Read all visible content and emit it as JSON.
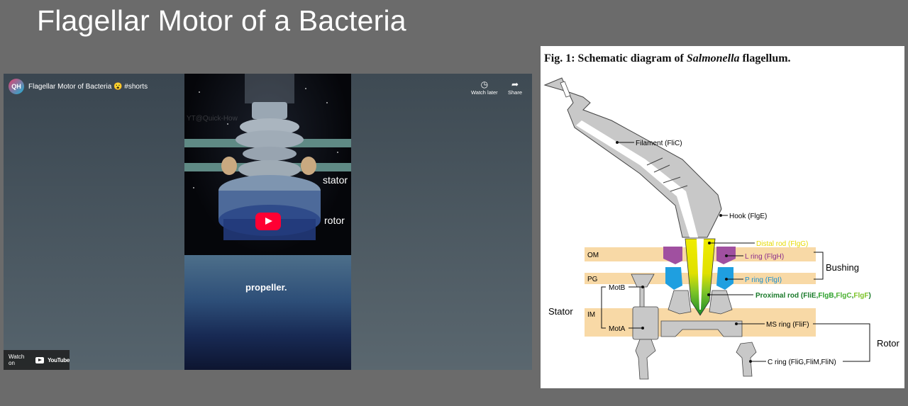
{
  "slide": {
    "title": "Flagellar Motor of a Bacteria"
  },
  "video": {
    "channel_avatar": "QH",
    "title": "Flagellar Motor of Bacteria 😮 #shorts",
    "watch_later_label": "Watch later",
    "share_label": "Share",
    "watch_on_label": "Watch on",
    "youtube_label": "YouTube",
    "watermark": "YT@Quick-How",
    "caption_stator": "stator",
    "caption_rotor": "rotor",
    "caption_propeller": "propeller.",
    "icons": {
      "watch_later": "clock-icon",
      "share": "share-arrow-icon",
      "play": "play-icon"
    }
  },
  "figure": {
    "caption_prefix": "Fig. 1: Schematic diagram of ",
    "caption_italic": "Salmonella",
    "caption_suffix": " flagellum.",
    "labels": {
      "filament": "Filament (FliC)",
      "hook": "Hook (FlgE)",
      "distal_rod": "Distal rod",
      "distal_rod_protein": "(FlgG)",
      "l_ring": "L ring",
      "l_ring_protein": "(FlgH)",
      "p_ring": "P ring",
      "p_ring_protein": "(FlgI)",
      "proximal_rod": "Proximal rod",
      "proximal_rod_open": "(FliE,",
      "proximal_rod_flgb": "FlgB",
      "proximal_rod_flgc": "FlgC",
      "proximal_rod_flgf": "FlgF",
      "proximal_rod_close": ")",
      "bushing": "Bushing",
      "mot_b": "MotB",
      "mot_a": "MotA",
      "stator": "Stator",
      "ms_ring": "MS ring (FliF)",
      "c_ring": "C ring (FliG,FliM,FliN)",
      "rotor": "Rotor",
      "om": "OM",
      "pg": "PG",
      "im": "IM"
    },
    "colors": {
      "membrane": "#f8d9a6",
      "structure_gray": "#c8c8c8",
      "distal_rod": "#e8e400",
      "l_ring": "#a050a0",
      "p_ring": "#1f9fe0",
      "proximal_rod": "#1a8a2a"
    }
  }
}
